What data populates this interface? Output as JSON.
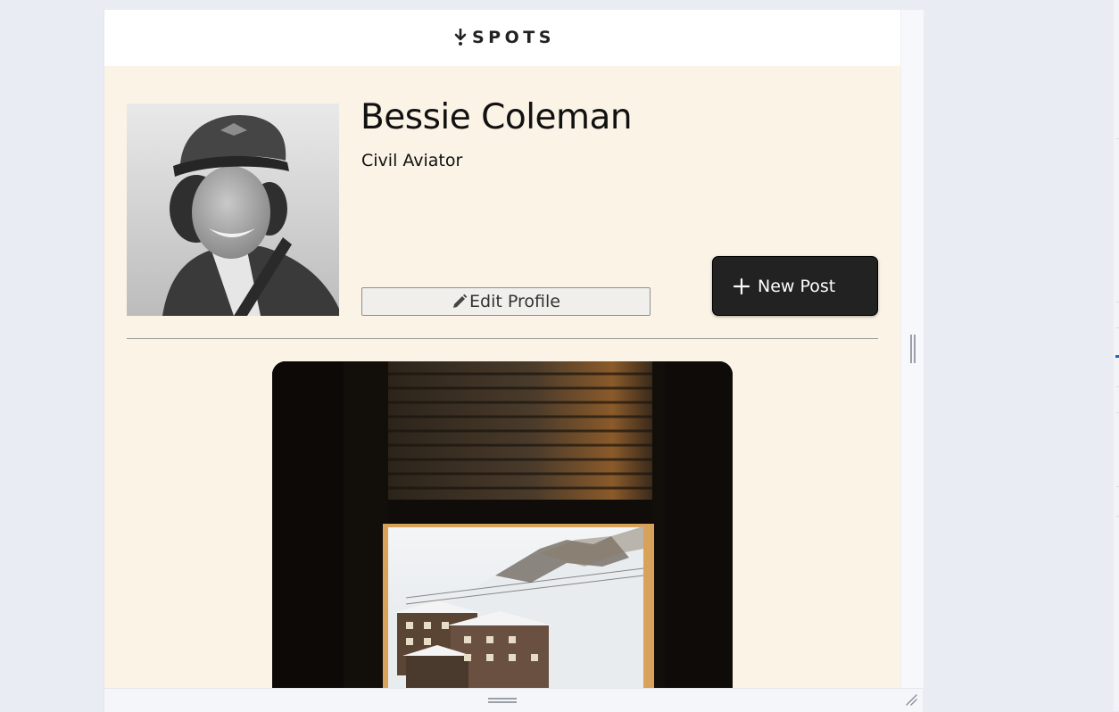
{
  "header": {
    "logo_text": "SPOTS",
    "logo_icon": "location-pin-icon"
  },
  "profile": {
    "name": "Bessie Coleman",
    "description": "Civil Aviator",
    "edit_button_label": "Edit Profile",
    "new_post_button_label": "New Post",
    "edit_icon": "pencil-icon",
    "add_icon": "plus-icon"
  },
  "posts": [
    {
      "image": "window-view-of-snowy-mountain-village"
    }
  ],
  "colors": {
    "page_background": "#fbf3e6",
    "header_background": "#ffffff",
    "new_post_button": "#222222",
    "edit_button": "#f0efeb",
    "text": "#111111"
  }
}
